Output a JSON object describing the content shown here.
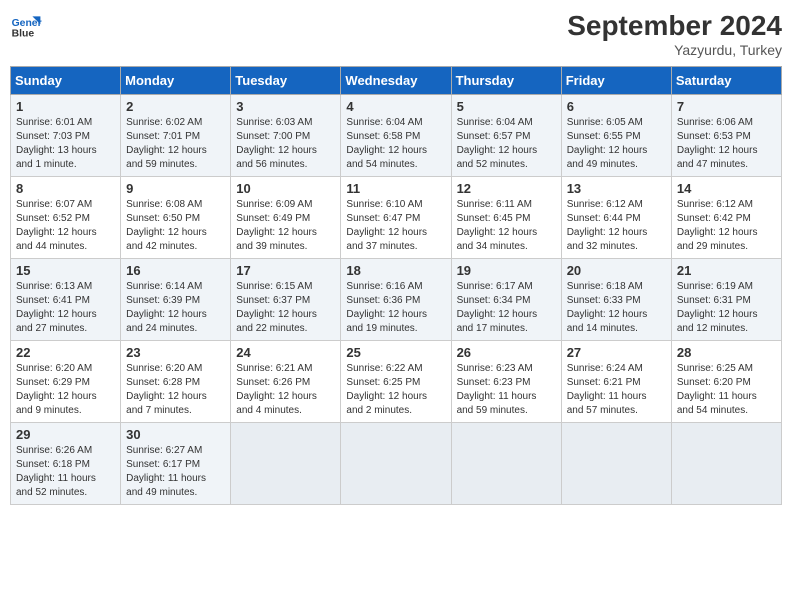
{
  "header": {
    "logo_line1": "General",
    "logo_line2": "Blue",
    "month": "September 2024",
    "location": "Yazyurdu, Turkey"
  },
  "weekdays": [
    "Sunday",
    "Monday",
    "Tuesday",
    "Wednesday",
    "Thursday",
    "Friday",
    "Saturday"
  ],
  "weeks": [
    [
      {
        "day": "1",
        "info": "Sunrise: 6:01 AM\nSunset: 7:03 PM\nDaylight: 13 hours\nand 1 minute."
      },
      {
        "day": "2",
        "info": "Sunrise: 6:02 AM\nSunset: 7:01 PM\nDaylight: 12 hours\nand 59 minutes."
      },
      {
        "day": "3",
        "info": "Sunrise: 6:03 AM\nSunset: 7:00 PM\nDaylight: 12 hours\nand 56 minutes."
      },
      {
        "day": "4",
        "info": "Sunrise: 6:04 AM\nSunset: 6:58 PM\nDaylight: 12 hours\nand 54 minutes."
      },
      {
        "day": "5",
        "info": "Sunrise: 6:04 AM\nSunset: 6:57 PM\nDaylight: 12 hours\nand 52 minutes."
      },
      {
        "day": "6",
        "info": "Sunrise: 6:05 AM\nSunset: 6:55 PM\nDaylight: 12 hours\nand 49 minutes."
      },
      {
        "day": "7",
        "info": "Sunrise: 6:06 AM\nSunset: 6:53 PM\nDaylight: 12 hours\nand 47 minutes."
      }
    ],
    [
      {
        "day": "8",
        "info": "Sunrise: 6:07 AM\nSunset: 6:52 PM\nDaylight: 12 hours\nand 44 minutes."
      },
      {
        "day": "9",
        "info": "Sunrise: 6:08 AM\nSunset: 6:50 PM\nDaylight: 12 hours\nand 42 minutes."
      },
      {
        "day": "10",
        "info": "Sunrise: 6:09 AM\nSunset: 6:49 PM\nDaylight: 12 hours\nand 39 minutes."
      },
      {
        "day": "11",
        "info": "Sunrise: 6:10 AM\nSunset: 6:47 PM\nDaylight: 12 hours\nand 37 minutes."
      },
      {
        "day": "12",
        "info": "Sunrise: 6:11 AM\nSunset: 6:45 PM\nDaylight: 12 hours\nand 34 minutes."
      },
      {
        "day": "13",
        "info": "Sunrise: 6:12 AM\nSunset: 6:44 PM\nDaylight: 12 hours\nand 32 minutes."
      },
      {
        "day": "14",
        "info": "Sunrise: 6:12 AM\nSunset: 6:42 PM\nDaylight: 12 hours\nand 29 minutes."
      }
    ],
    [
      {
        "day": "15",
        "info": "Sunrise: 6:13 AM\nSunset: 6:41 PM\nDaylight: 12 hours\nand 27 minutes."
      },
      {
        "day": "16",
        "info": "Sunrise: 6:14 AM\nSunset: 6:39 PM\nDaylight: 12 hours\nand 24 minutes."
      },
      {
        "day": "17",
        "info": "Sunrise: 6:15 AM\nSunset: 6:37 PM\nDaylight: 12 hours\nand 22 minutes."
      },
      {
        "day": "18",
        "info": "Sunrise: 6:16 AM\nSunset: 6:36 PM\nDaylight: 12 hours\nand 19 minutes."
      },
      {
        "day": "19",
        "info": "Sunrise: 6:17 AM\nSunset: 6:34 PM\nDaylight: 12 hours\nand 17 minutes."
      },
      {
        "day": "20",
        "info": "Sunrise: 6:18 AM\nSunset: 6:33 PM\nDaylight: 12 hours\nand 14 minutes."
      },
      {
        "day": "21",
        "info": "Sunrise: 6:19 AM\nSunset: 6:31 PM\nDaylight: 12 hours\nand 12 minutes."
      }
    ],
    [
      {
        "day": "22",
        "info": "Sunrise: 6:20 AM\nSunset: 6:29 PM\nDaylight: 12 hours\nand 9 minutes."
      },
      {
        "day": "23",
        "info": "Sunrise: 6:20 AM\nSunset: 6:28 PM\nDaylight: 12 hours\nand 7 minutes."
      },
      {
        "day": "24",
        "info": "Sunrise: 6:21 AM\nSunset: 6:26 PM\nDaylight: 12 hours\nand 4 minutes."
      },
      {
        "day": "25",
        "info": "Sunrise: 6:22 AM\nSunset: 6:25 PM\nDaylight: 12 hours\nand 2 minutes."
      },
      {
        "day": "26",
        "info": "Sunrise: 6:23 AM\nSunset: 6:23 PM\nDaylight: 11 hours\nand 59 minutes."
      },
      {
        "day": "27",
        "info": "Sunrise: 6:24 AM\nSunset: 6:21 PM\nDaylight: 11 hours\nand 57 minutes."
      },
      {
        "day": "28",
        "info": "Sunrise: 6:25 AM\nSunset: 6:20 PM\nDaylight: 11 hours\nand 54 minutes."
      }
    ],
    [
      {
        "day": "29",
        "info": "Sunrise: 6:26 AM\nSunset: 6:18 PM\nDaylight: 11 hours\nand 52 minutes."
      },
      {
        "day": "30",
        "info": "Sunrise: 6:27 AM\nSunset: 6:17 PM\nDaylight: 11 hours\nand 49 minutes."
      },
      {
        "day": "",
        "info": ""
      },
      {
        "day": "",
        "info": ""
      },
      {
        "day": "",
        "info": ""
      },
      {
        "day": "",
        "info": ""
      },
      {
        "day": "",
        "info": ""
      }
    ]
  ]
}
